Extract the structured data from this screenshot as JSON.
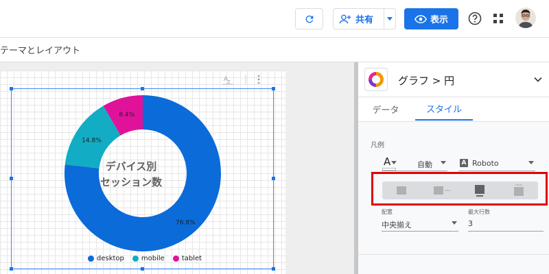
{
  "topbar": {
    "share_label": "共有",
    "view_label": "表示"
  },
  "menubar": {
    "theme_label": "テーマとレイアウト"
  },
  "chart_data": {
    "type": "pie",
    "donut": true,
    "title": "デバイス別\nセッション数",
    "title_lines": [
      "デバイス別",
      "セッション数"
    ],
    "categories": [
      "desktop",
      "mobile",
      "tablet"
    ],
    "values": [
      76.8,
      14.8,
      8.4
    ],
    "labels": [
      "76.8%",
      "14.8%",
      "8.4%"
    ],
    "colors": [
      "#0b6bd9",
      "#12acc4",
      "#e0129a"
    ],
    "legend_position": "bottom"
  },
  "panel": {
    "title": "グラフ > 円",
    "tabs": [
      {
        "label": "データ",
        "active": false
      },
      {
        "label": "スタイル",
        "active": true
      }
    ],
    "legend_section": "凡例",
    "font_size_value": "自動",
    "font_family_value": "Roboto",
    "font_badge": "A",
    "legend_positions": [
      "none",
      "right",
      "bottom",
      "top"
    ],
    "legend_position_selected": "bottom",
    "align_label": "配置",
    "align_value": "中央揃え",
    "max_lines_label": "最大行数",
    "max_lines_value": "3"
  },
  "colors": {
    "accent": "#1a73e8",
    "highlight": "#e00000"
  }
}
